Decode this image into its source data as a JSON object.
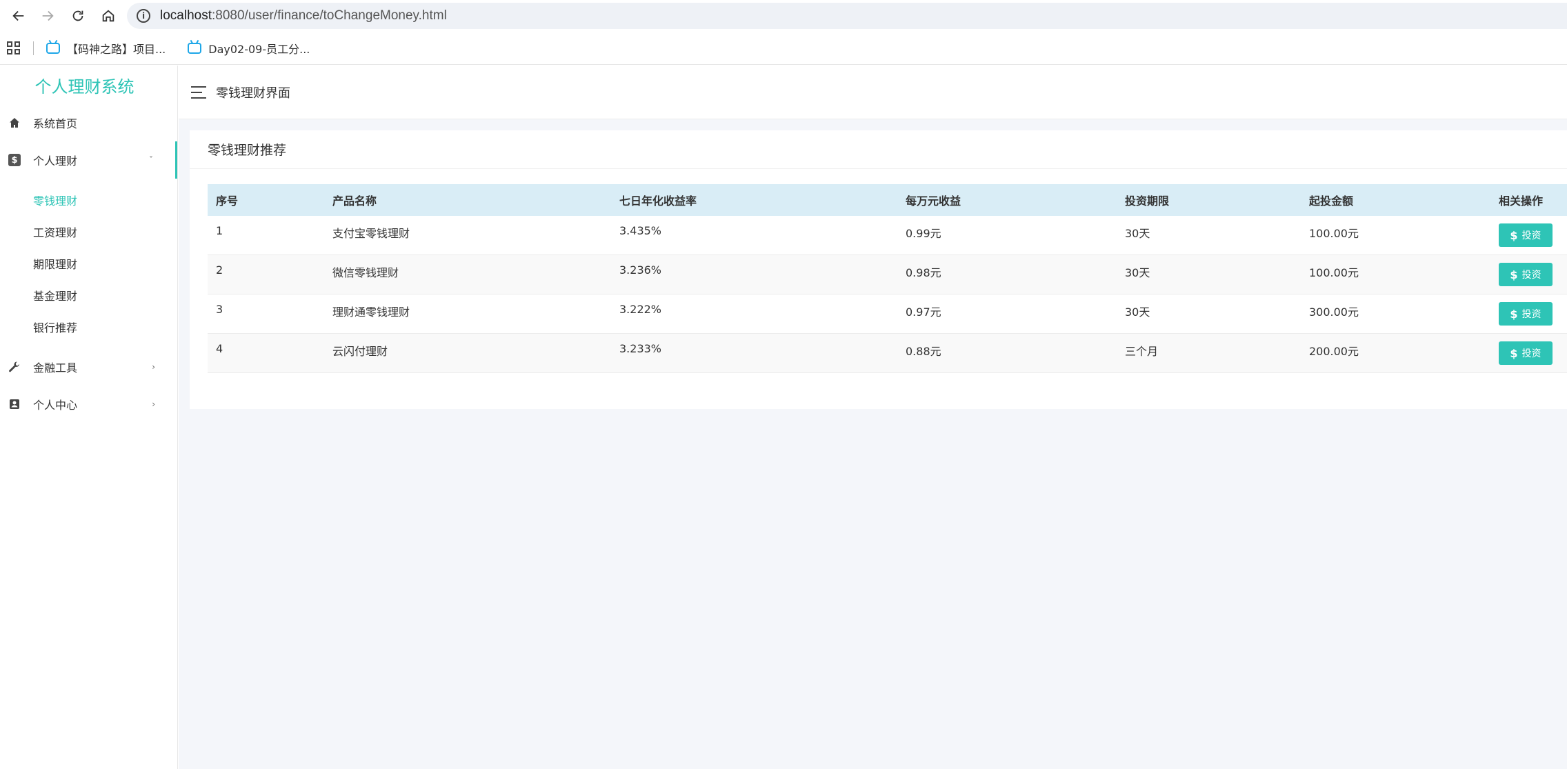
{
  "browser": {
    "url_host": "localhost",
    "url_path": ":8080/user/finance/toChangeMoney.html",
    "bookmarks": [
      "【码神之路】项目...",
      "Day02-09-员工分..."
    ]
  },
  "sidebar": {
    "brand": "个人理财系统",
    "items": [
      {
        "label": "系统首页"
      },
      {
        "label": "个人理财",
        "arrow": "ˇ"
      },
      {
        "label": "金融工具",
        "arrow": "›"
      },
      {
        "label": "个人中心",
        "arrow": "›"
      }
    ],
    "subitems": [
      "零钱理财",
      "工资理财",
      "期限理财",
      "基金理财",
      "银行推荐"
    ]
  },
  "topbar": {
    "title": "零钱理财界面"
  },
  "card": {
    "title": "零钱理财推荐",
    "columns": [
      "序号",
      "产品名称",
      "七日年化收益率",
      "每万元收益",
      "投资期限",
      "起投金额",
      "相关操作"
    ],
    "rows": [
      {
        "no": "1",
        "name": "支付宝零钱理财",
        "rate": "3.435%",
        "per10k": "0.99元",
        "term": "30天",
        "min": "100.00元"
      },
      {
        "no": "2",
        "name": "微信零钱理财",
        "rate": "3.236%",
        "per10k": "0.98元",
        "term": "30天",
        "min": "100.00元"
      },
      {
        "no": "3",
        "name": "理财通零钱理财",
        "rate": "3.222%",
        "per10k": "0.97元",
        "term": "30天",
        "min": "300.00元"
      },
      {
        "no": "4",
        "name": "云闪付理财",
        "rate": "3.233%",
        "per10k": "0.88元",
        "term": "三个月",
        "min": "200.00元"
      }
    ],
    "invest_label": "投资",
    "invest_symbol": "$"
  },
  "colors": {
    "accent": "#2ec4b6",
    "header_bg": "#d9edf6"
  }
}
